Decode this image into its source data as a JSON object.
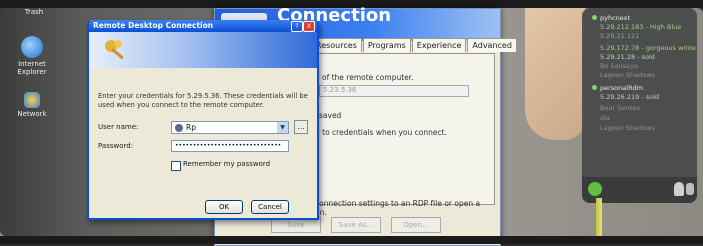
{
  "desktop": {
    "icons": [
      {
        "label": "Trash",
        "icon": "trash-icon"
      },
      {
        "label": "Internet Explorer",
        "icon": "internet-explorer-icon"
      },
      {
        "label": "Network",
        "icon": "network-icon"
      }
    ]
  },
  "rdc_window": {
    "banner_title": "Connection",
    "tabs": [
      "Resources",
      "Programs",
      "Experience",
      "Advanced"
    ],
    "lines": [
      "e of the remote computer.",
      "5.23.5.36",
      "saved",
      "d to credentials when you connect.",
      "connection settings to an RDP file or open a",
      "on."
    ],
    "buttons": [
      "Save",
      "Save As...",
      "Open..."
    ]
  },
  "dialog": {
    "title": "Remote Desktop Connection",
    "message": "Enter your credentials for 5.29.5.36. These credentials will be used when you connect to the remote computer.",
    "user_label": "User name:",
    "user_value": "Rp",
    "password_label": "Password:",
    "password_value": "••••••••••••••••••••••••••••••",
    "remember_label": "Remember my password",
    "remember_checked": false,
    "ok_label": "OK",
    "cancel_label": "Cancel",
    "help_btn": "?",
    "close_btn": "X"
  },
  "sidebar": {
    "groups": [
      {
        "name": "pyhcnext",
        "entries": [
          "5.29.212.183 - High Blue",
          "5.29.21.121",
          "5.29.172.78 - gorgeous winte",
          "5.29.21.28 - sold",
          "Bo Sanseyo",
          "Lagoon Shadows"
        ]
      },
      {
        "name": "personalRdm",
        "entries": [
          "5.29.26.219 - sold",
          "Bear Senses",
          "dia",
          "Lagoon Shadows"
        ]
      }
    ],
    "accent": "#8ad36a"
  }
}
